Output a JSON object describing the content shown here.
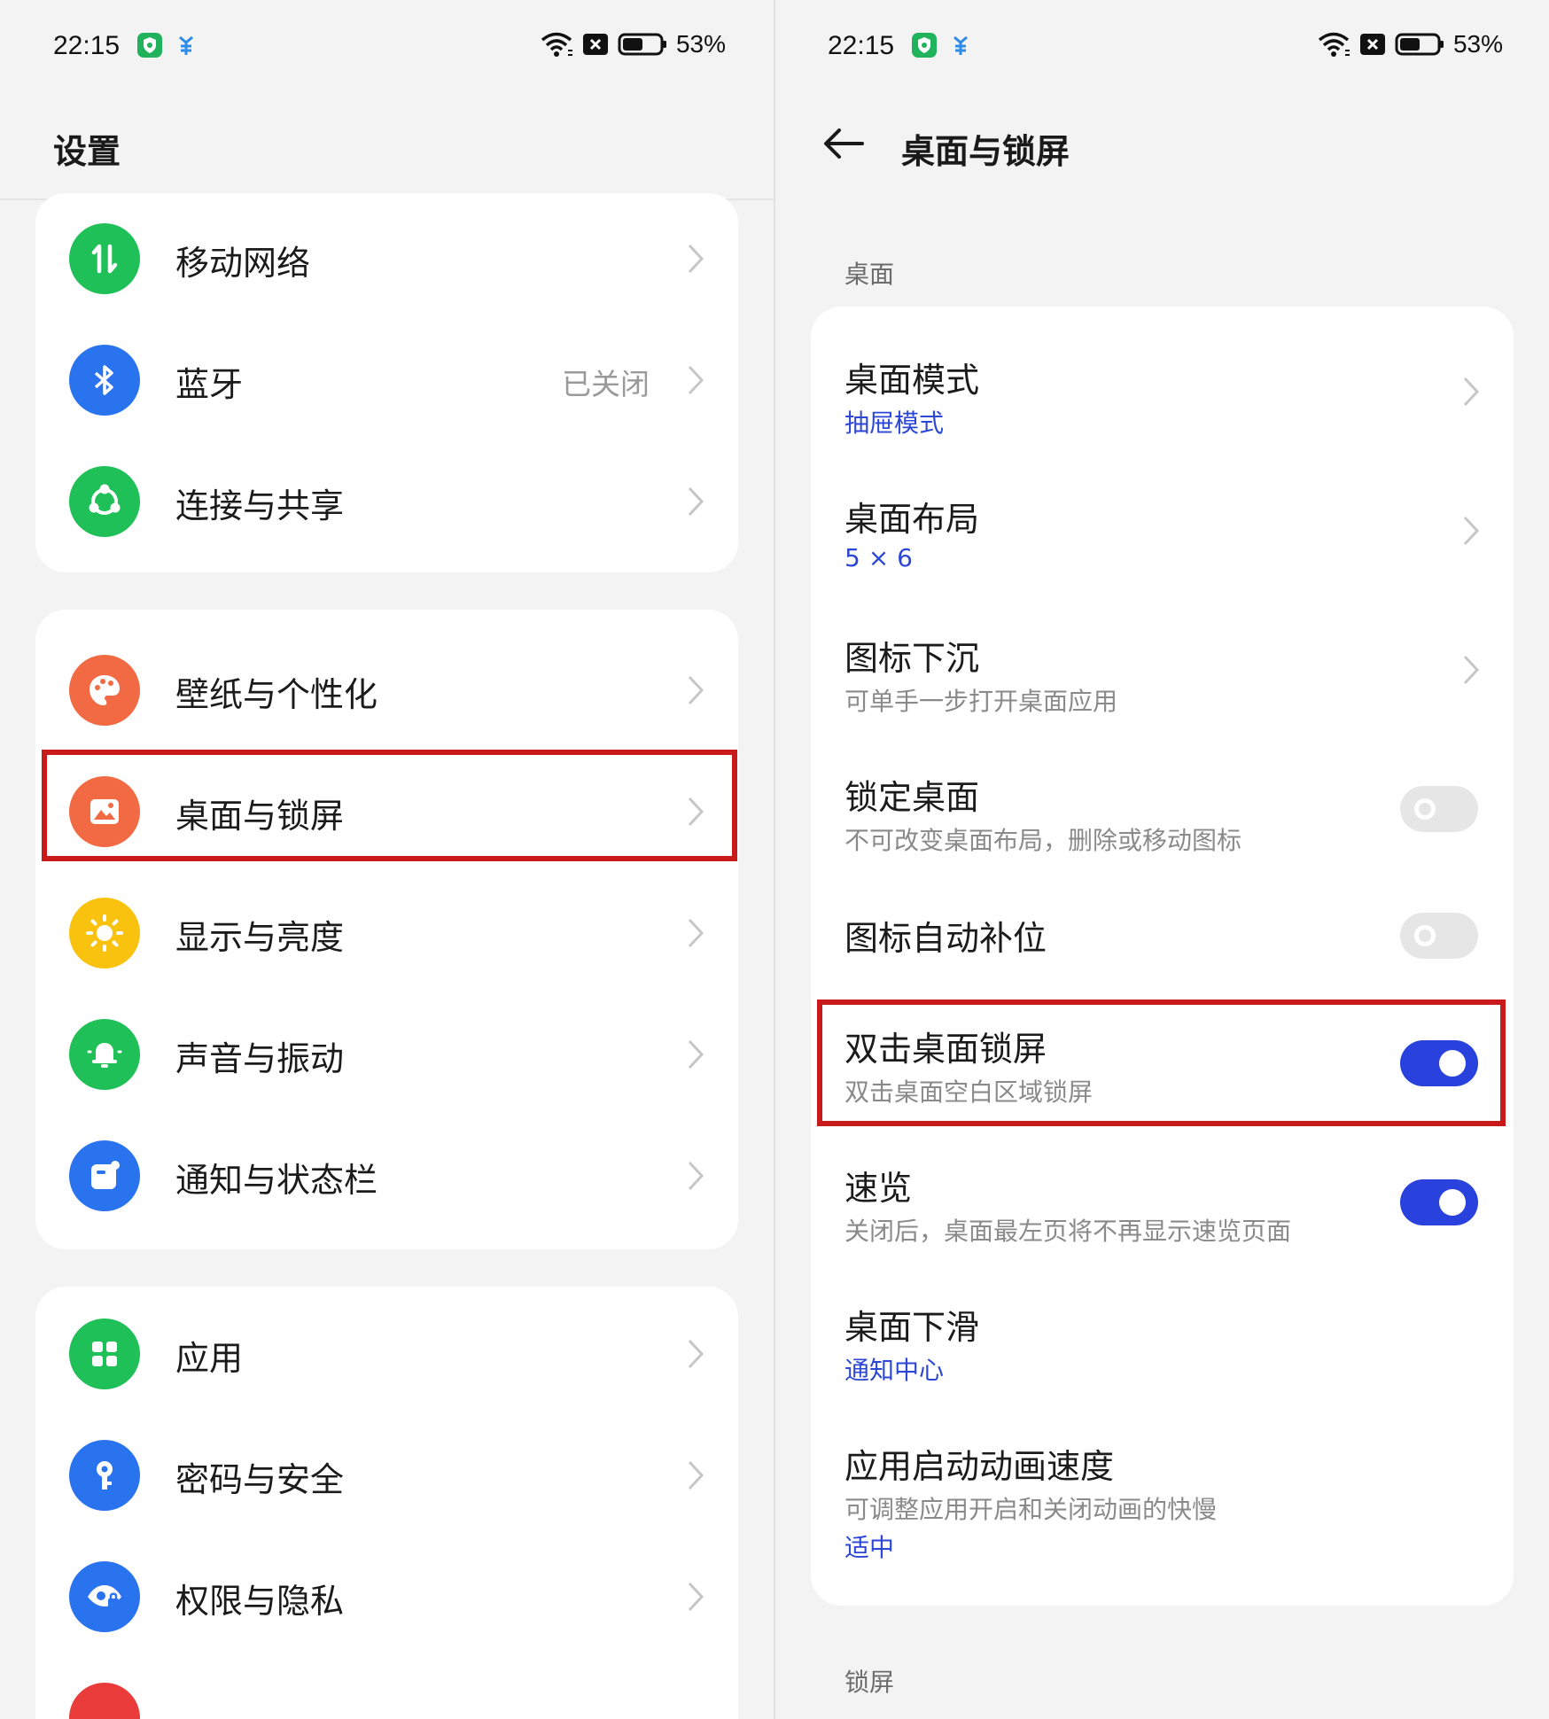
{
  "status_bar": {
    "time": "22:15",
    "battery": "53%",
    "icons": [
      "shield-app-icon",
      "person-app-icon",
      "wifi-icon",
      "sim-blocked-icon",
      "battery-icon"
    ]
  },
  "left": {
    "title": "设置",
    "groups": [
      {
        "items": [
          {
            "label": "移动网络",
            "icon": "mobile-data-icon",
            "color": "#1fc057"
          },
          {
            "label": "蓝牙",
            "value": "已关闭",
            "icon": "bluetooth-icon",
            "color": "#2a73ee"
          },
          {
            "label": "连接与共享",
            "icon": "connection-share-icon",
            "color": "#1fc057"
          }
        ]
      },
      {
        "items": [
          {
            "label": "壁纸与个性化",
            "icon": "palette-icon",
            "color": "#f26a43"
          },
          {
            "label": "桌面与锁屏",
            "icon": "image-icon",
            "color": "#f26a43"
          },
          {
            "label": "显示与亮度",
            "icon": "sun-icon",
            "color": "#f8c20e"
          },
          {
            "label": "声音与振动",
            "icon": "bell-icon",
            "color": "#1fc057"
          },
          {
            "label": "通知与状态栏",
            "icon": "notification-icon",
            "color": "#2a73ee"
          }
        ]
      },
      {
        "items": [
          {
            "label": "应用",
            "icon": "apps-grid-icon",
            "color": "#1fc057"
          },
          {
            "label": "密码与安全",
            "icon": "key-icon",
            "color": "#2a73ee"
          },
          {
            "label": "权限与隐私",
            "icon": "privacy-eye-icon",
            "color": "#2a73ee"
          }
        ]
      }
    ]
  },
  "right": {
    "title": "桌面与锁屏",
    "sections": [
      {
        "label": "桌面",
        "items": [
          {
            "title": "桌面模式",
            "sub_value": "抽屉模式",
            "type": "chevron"
          },
          {
            "title": "桌面布局",
            "sub_value": "5 × 6",
            "type": "chevron"
          },
          {
            "title": "图标下沉",
            "subtitle": "可单手一步打开桌面应用",
            "type": "chevron"
          },
          {
            "title": "锁定桌面",
            "subtitle": "不可改变桌面布局，删除或移动图标",
            "type": "toggle",
            "on": false
          },
          {
            "title": "图标自动补位",
            "type": "toggle",
            "on": false
          },
          {
            "title": "双击桌面锁屏",
            "subtitle": "双击桌面空白区域锁屏",
            "type": "toggle",
            "on": true
          },
          {
            "title": "速览",
            "subtitle": "关闭后，桌面最左页将不再显示速览页面",
            "type": "toggle",
            "on": true
          },
          {
            "title": "桌面下滑",
            "sub_value": "通知中心",
            "type": "plain"
          },
          {
            "title": "应用启动动画速度",
            "subtitle": "可调整应用开启和关闭动画的快慢",
            "sub_value": "适中",
            "type": "plain"
          }
        ]
      },
      {
        "label": "锁屏"
      }
    ]
  },
  "colors": {
    "accent": "#2941dd",
    "link": "#2c46d6",
    "highlight": "#c81a1a"
  }
}
